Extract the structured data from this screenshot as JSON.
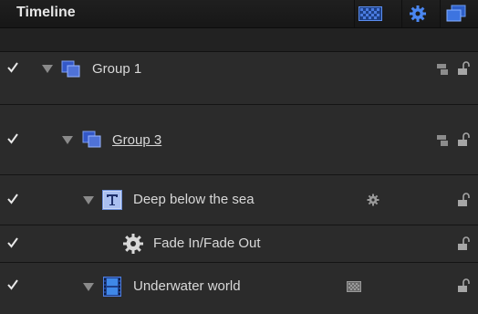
{
  "window": {
    "title": "Timeline"
  },
  "toolbar": {
    "buttons": [
      {
        "name": "checker-view",
        "icon": "checkerboard-icon"
      },
      {
        "name": "settings",
        "icon": "gear-icon"
      },
      {
        "name": "layers",
        "icon": "layers-icon"
      }
    ]
  },
  "rows": [
    {
      "label": "Group 1",
      "checked": true,
      "expanded": true,
      "icon": "group-icon"
    },
    {
      "label": "Group 3",
      "checked": true,
      "expanded": true,
      "icon": "group-icon"
    },
    {
      "label": "Deep below the sea",
      "checked": true,
      "expanded": true,
      "icon": "text-layer-icon"
    },
    {
      "label": "Fade In/Fade Out",
      "checked": true,
      "icon": "behavior-gear-icon"
    },
    {
      "label": "Underwater world",
      "checked": true,
      "expanded": true,
      "icon": "film-icon"
    }
  ],
  "colors": {
    "accent": "#3d6fd6",
    "background": "#2b2b2b",
    "titlebar": "#1b1b1b"
  }
}
